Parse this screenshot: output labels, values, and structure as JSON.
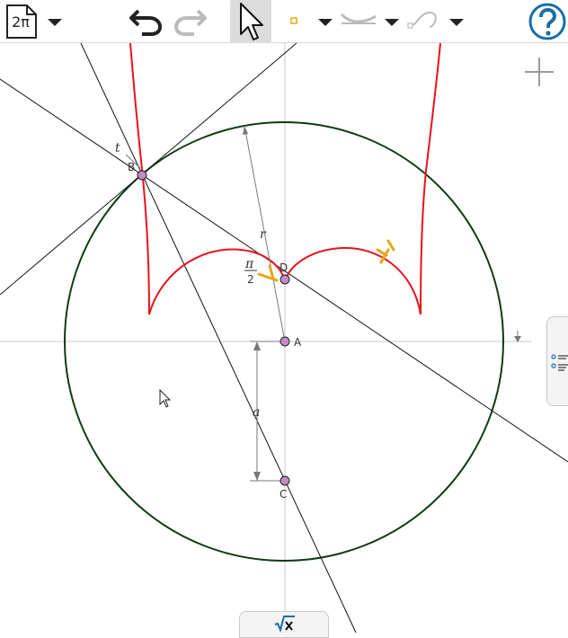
{
  "toolbar": {
    "file_label": "2π",
    "tools": [
      "file-menu",
      "undo",
      "redo",
      "select",
      "point",
      "line",
      "curve",
      "help"
    ]
  },
  "canvas": {
    "points": [
      {
        "name": "A",
        "label": "A"
      },
      {
        "name": "B",
        "label": "B"
      },
      {
        "name": "C",
        "label": "C"
      },
      {
        "name": "D",
        "label": "D"
      }
    ],
    "labels": {
      "r": "r",
      "a": "a",
      "t": "t",
      "pi": "π",
      "two": "2"
    }
  },
  "colors": {
    "circle": "#0d3b12",
    "curve": "#e8141c",
    "angle_marker": "#e8a514",
    "point_fill": "#c888c8",
    "line": "#111111",
    "axis": "#c8c8c8",
    "dimension": "#777777",
    "help": "#1a6ea8",
    "formula_icon": "#1a6ea8"
  },
  "icons": {
    "file": "file-icon",
    "undo": "undo-arrow-icon",
    "redo": "redo-arrow-icon",
    "select": "pointer-arrow-icon",
    "help": "question-mark-icon",
    "zoom": "plus-icon",
    "panel": "list-icon",
    "input": "sqrt-x-icon"
  }
}
